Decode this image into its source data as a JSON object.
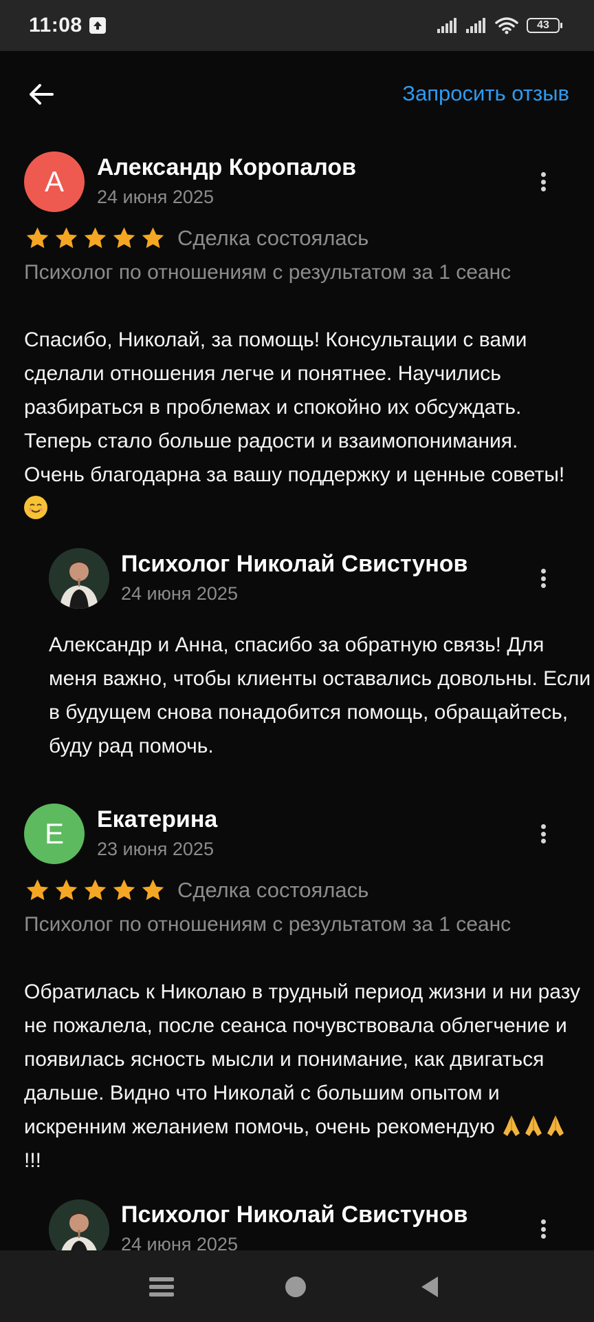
{
  "status_bar": {
    "time": "11:08",
    "battery": "43",
    "icons": [
      "upload-icon",
      "signal-icon",
      "signal-icon",
      "wifi-icon",
      "battery-icon"
    ]
  },
  "header": {
    "back_icon": "arrow-left-icon",
    "request_review_label": "Запросить отзыв",
    "accent_color": "#2f9bf0"
  },
  "reviews": [
    {
      "author_initial": "А",
      "avatar_color": "#ef5a50",
      "author": "Александр Коропалов",
      "date": "24 июня 2025",
      "rating": 5,
      "deal_status": "Сделка состоялась",
      "service": "Психолог по отношениям с результатом за 1 сеанс",
      "text": "Спасибо, Николай, за помощь! Консультации с вами сделали отношения легче и понятнее. Научились разбираться в проблемах и спокойно их обсуждать. Теперь стало больше радости и взаимопонимания. Очень благодарна за вашу поддержку и ценные советы!",
      "reply": {
        "author": "Психолог Николай Свистунов",
        "date": "24 июня 2025",
        "text": "Александр и Анна,  спасибо за обратную связь! Для меня важно, чтобы клиенты оставались довольны. Если в будущем снова  понадобится помощь, обращайтесь, буду рад помочь."
      }
    },
    {
      "author_initial": "Е",
      "avatar_color": "#5dba5f",
      "author": "Екатерина",
      "date": "23 июня 2025",
      "rating": 5,
      "deal_status": "Сделка состоялась",
      "service": "Психолог по отношениям с результатом за 1 сеанс",
      "text": "Обратилась к Николаю в трудный период жизни и ни разу не пожалела, после сеанса почувствовала облегчение и появилась ясность мысли и понимание, как двигаться дальше. Видно что Николай с большим опытом и искренним желанием помочь, очень рекомендую",
      "text_suffix": "!!!",
      "reply": {
        "author": "Психолог Николай Свистунов",
        "date": "24 июня 2025"
      }
    }
  ],
  "star_color": "#f5a623",
  "nav_bar": {
    "icons": [
      "menu-icon",
      "home-circle-icon",
      "back-triangle-icon"
    ]
  }
}
